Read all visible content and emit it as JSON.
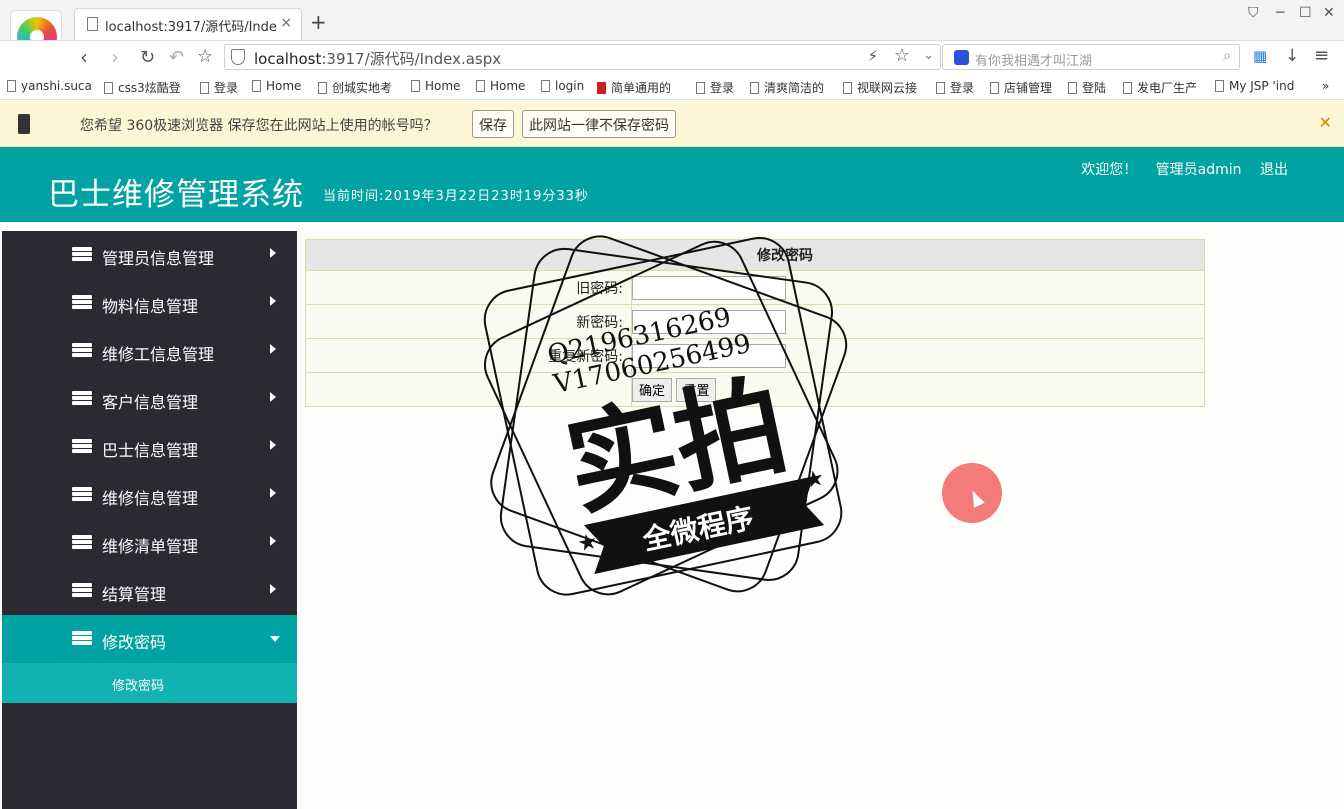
{
  "browser": {
    "tab_title": "localhost:3917/源代码/Index.aspx",
    "tab_close": "×",
    "new_tab": "+",
    "window_controls": [
      "⛉",
      "─",
      "☐",
      "✕"
    ],
    "address": {
      "host": "localhost",
      "rest": ":3917/源代码/Index.aspx"
    },
    "search_placeholder": "有你我相遇才叫江湖",
    "bookmarks": [
      "yanshi.suca",
      "css3炫酷登",
      "登录",
      "Home",
      "创城实地考",
      "Home",
      "Home",
      "login",
      "简单通用的",
      "登录",
      "清爽简洁的",
      "视联网云接",
      "登录",
      "店铺管理",
      "登陆",
      "发电厂生产",
      "My JSP 'ind"
    ],
    "bookmarks_more": "»"
  },
  "infobar": {
    "message": "您希望 360极速浏览器 保存您在此网站上使用的帐号吗？",
    "save_label": "保存",
    "never_label": "此网站一律不保存密码",
    "close": "✕"
  },
  "header": {
    "title": "巴士维修管理系统",
    "time": "当前时间:2019年3月22日23时19分33秒",
    "welcome": "欢迎您！",
    "user": "管理员admin",
    "logout": "退出"
  },
  "sidebar": {
    "items": [
      {
        "label": "管理员信息管理"
      },
      {
        "label": "物料信息管理"
      },
      {
        "label": "维修工信息管理"
      },
      {
        "label": "客户信息管理"
      },
      {
        "label": "巴士信息管理"
      },
      {
        "label": "维修信息管理"
      },
      {
        "label": "维修清单管理"
      },
      {
        "label": "结算管理"
      },
      {
        "label": "修改密码"
      }
    ],
    "active_sub": "修改密码"
  },
  "form": {
    "heading": "修改密码",
    "old_label": "旧密码:",
    "new_label": "新密码:",
    "confirm_label": "重复新密码:",
    "old_value": "",
    "new_value": "",
    "confirm_value": "",
    "submit": "确定",
    "reset": "重置"
  },
  "watermark": {
    "qq": "Q2196316269",
    "v": "V17060256499",
    "main": "实拍",
    "ribbon": "全微程序"
  }
}
